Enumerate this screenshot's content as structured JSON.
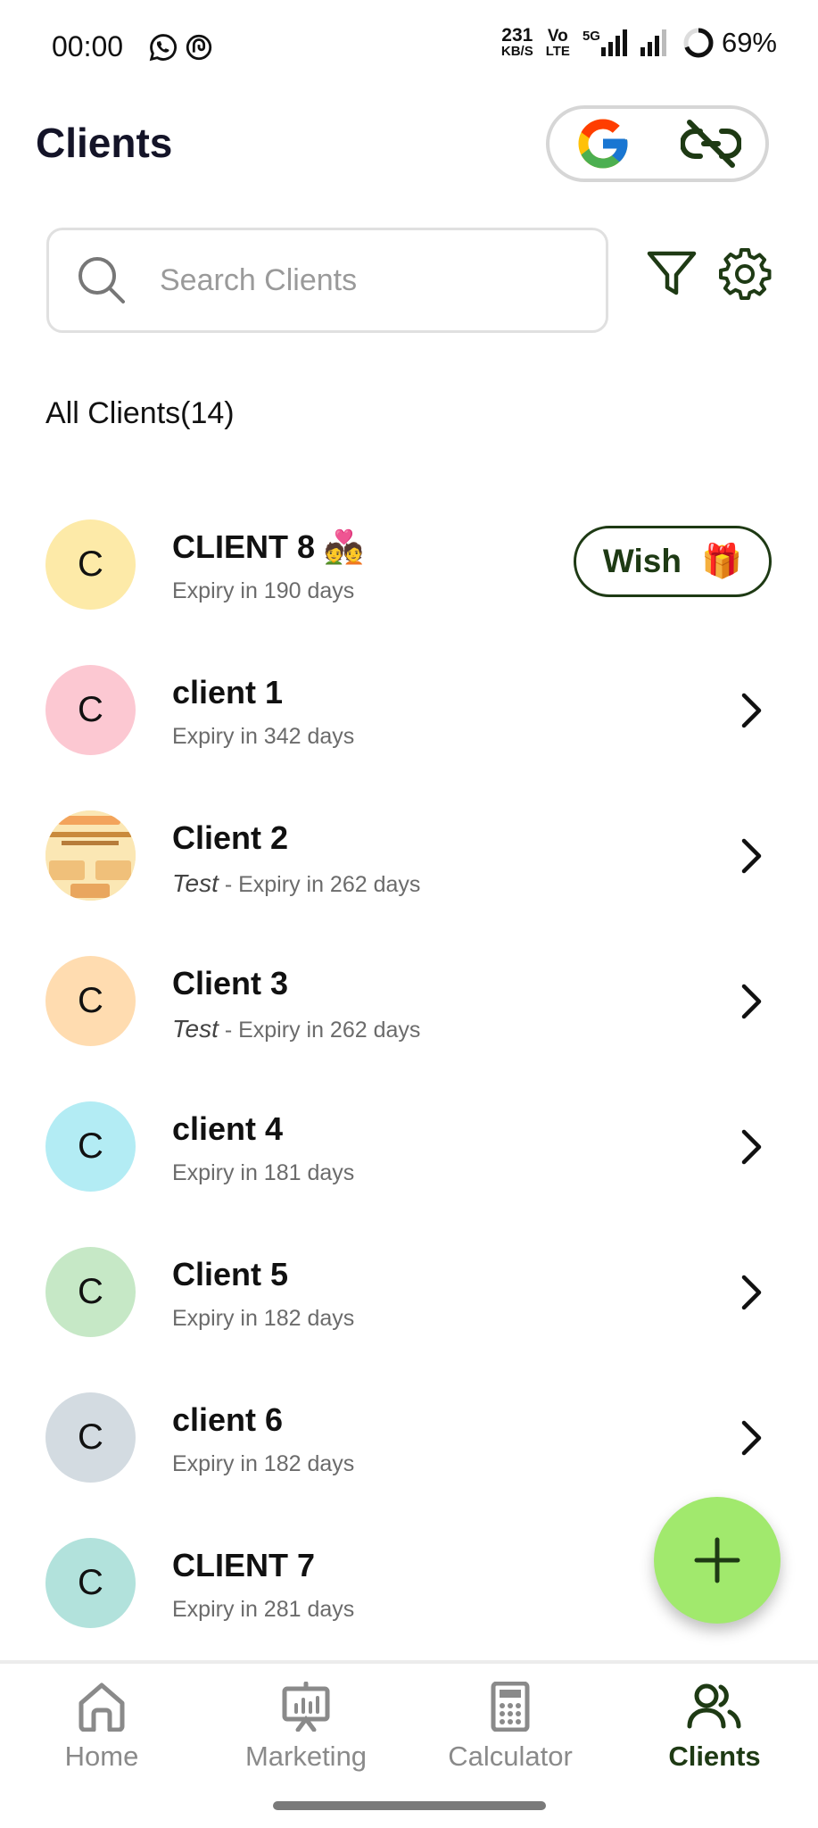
{
  "status_bar": {
    "time": "00:00",
    "net_speed_top": "231",
    "net_speed_unit": "KB/S",
    "volte_top": "Vo",
    "volte_bottom": "LTE",
    "network": "5G",
    "battery": "69%"
  },
  "header": {
    "title": "Clients",
    "google_icon": "google-logo-icon",
    "link_icon": "unlink-icon"
  },
  "search": {
    "placeholder": "Search Clients",
    "value": ""
  },
  "list_header": "All Clients(14)",
  "clients": [
    {
      "initial": "C",
      "name": "CLIENT 8 💑",
      "note": "",
      "expiry": "Expiry in 190 days",
      "avatar_color": "#fdeaa8",
      "action": "Wish",
      "action_icon": "🎁"
    },
    {
      "initial": "C",
      "name": "client 1",
      "note": "",
      "expiry": "Expiry in 342 days",
      "avatar_color": "#fcc8d2"
    },
    {
      "initial": "",
      "name": "Client 2",
      "note": "Test",
      "expiry": " - Expiry in 262 days",
      "avatar_color": "#fbe3a8"
    },
    {
      "initial": "C",
      "name": "Client 3",
      "note": "Test",
      "expiry": " - Expiry in 262 days",
      "avatar_color": "#ffdcb0"
    },
    {
      "initial": "C",
      "name": "client 4",
      "note": "",
      "expiry": "Expiry in 181 days",
      "avatar_color": "#b3ecf4"
    },
    {
      "initial": "C",
      "name": "Client 5",
      "note": "",
      "expiry": "Expiry in 182 days",
      "avatar_color": "#c6e8c6"
    },
    {
      "initial": "C",
      "name": "client 6",
      "note": "",
      "expiry": "Expiry in 182 days",
      "avatar_color": "#d3dbe1"
    },
    {
      "initial": "C",
      "name": "CLIENT 7",
      "note": "",
      "expiry": "Expiry in 281 days",
      "avatar_color": "#b2e2dc"
    }
  ],
  "nav": {
    "home": "Home",
    "marketing": "Marketing",
    "calculator": "Calculator",
    "clients": "Clients"
  },
  "colors": {
    "accent": "#1e3a14",
    "fab": "#a1e96d"
  }
}
